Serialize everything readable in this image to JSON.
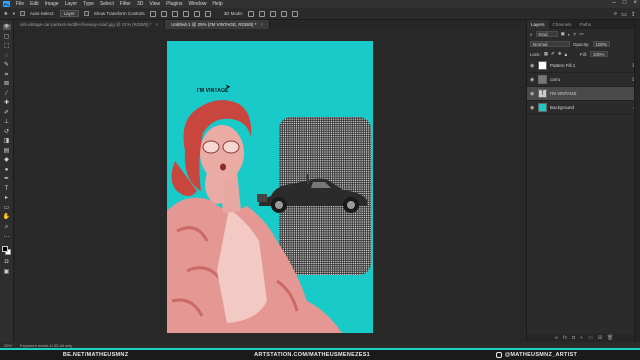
{
  "menu": {
    "app_icon": "Ps",
    "items": [
      "File",
      "Edit",
      "Image",
      "Layer",
      "Type",
      "Select",
      "Filter",
      "3D",
      "View",
      "Plugins",
      "Window",
      "Help"
    ]
  },
  "options": {
    "auto_select_label": "Auto-Select:",
    "auto_select_value": "Layer",
    "transform_label": "Show Transform Controls",
    "mode_3d": "3D Mode:"
  },
  "tabs": [
    {
      "label": "old-vintage-car-parked-middle-freeway-road.jpg @ 21% (RGB/8) *",
      "active": false
    },
    {
      "label": "Untitled-1 @ 25% (I'M VINTAGE, RGB/8) *",
      "active": true
    }
  ],
  "artwork": {
    "headline": "I'M VINTAGE"
  },
  "panels": {
    "tabs": [
      "Layers",
      "Channels",
      "Paths"
    ],
    "kind": "Kind",
    "blend_mode": "Normal",
    "opacity_label": "Opacity:",
    "opacity_value": "100%",
    "lock_label": "Lock:",
    "fill_label": "Fill:",
    "fill_value": "100%",
    "layers": [
      {
        "name": "Pattern Fill 1",
        "thumb_color": "#ffffff",
        "selected": false
      },
      {
        "name": "carro",
        "thumb_color": "#777777",
        "selected": false
      },
      {
        "name": "I'M VINTAGE",
        "thumb_color": "#cccccc",
        "selected": true
      },
      {
        "name": "Background",
        "thumb_color": "#19cbc8",
        "selected": false
      }
    ]
  },
  "status": {
    "zoom": "25%",
    "info": "Exposure works in 32-bit only"
  },
  "footer": {
    "behance": "BE.NET/MATHEUSMNZ",
    "artstation": "ARTSTATION.COM/MATHEUSMENEZES1",
    "instagram": "@MATHEUSMNZ_ARTIST"
  },
  "colors": {
    "accent": "#1ed1c4",
    "canvas_bg": "#19cbc8",
    "photo_tint": "#e48c88"
  }
}
